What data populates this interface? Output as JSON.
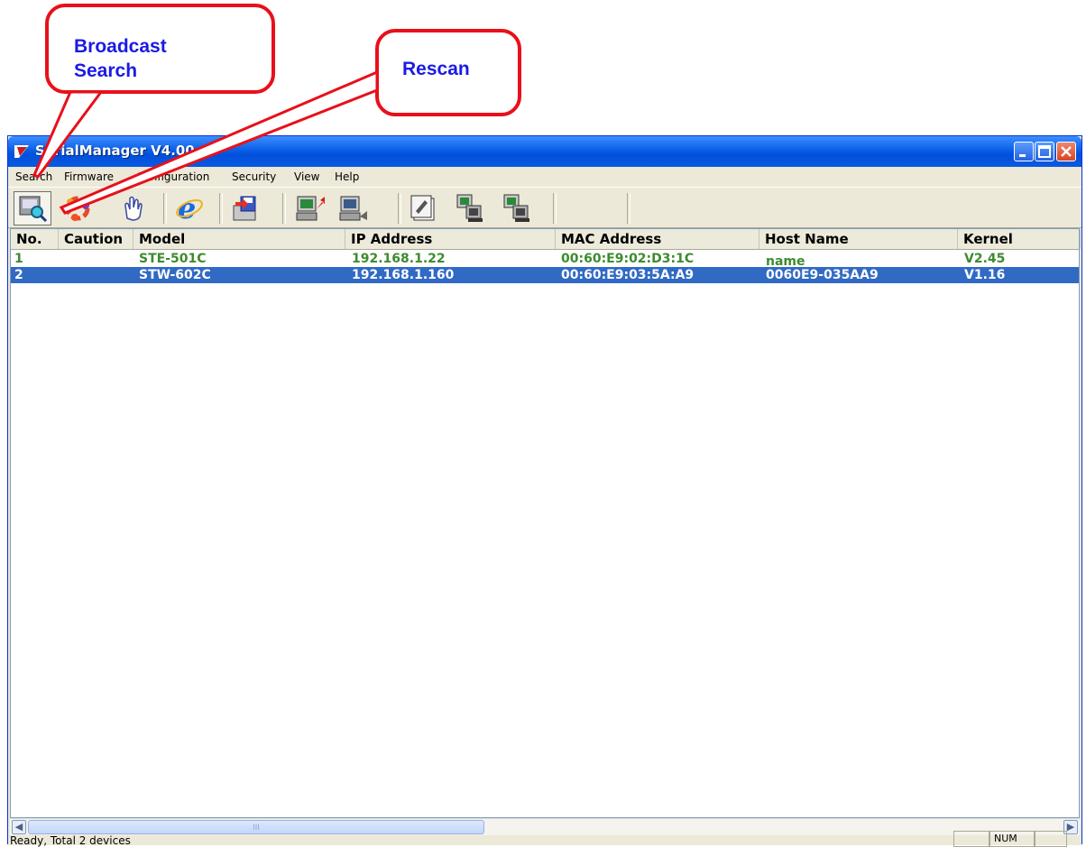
{
  "callouts": {
    "broadcast_line1": "Broadcast",
    "broadcast_line2": "Search",
    "rescan": "Rescan"
  },
  "window": {
    "title": "SerialManager V4.00 ..."
  },
  "menu": [
    "Search",
    "Firmware",
    "Configuration",
    "Security",
    "View",
    "Help"
  ],
  "toolbar_icons": [
    "broadcast-search-icon",
    "rescan-icon",
    "locate-icon",
    "web-browser-icon",
    "save-icon",
    "console-icon",
    "upload-icon",
    "config-icon",
    "network-icon",
    "network2-icon"
  ],
  "columns": [
    "No.",
    "Caution",
    "Model",
    "IP Address",
    "MAC Address",
    "Host Name",
    "Kernel"
  ],
  "rows": [
    {
      "no": "1",
      "caution": "",
      "model": "STE-501C",
      "ip": "192.168.1.22",
      "mac": "00:60:E9:02:D3:1C",
      "host": "name",
      "kernel": "V2.45"
    },
    {
      "no": "2",
      "caution": "",
      "model": "STW-602C",
      "ip": "192.168.1.160",
      "mac": "00:60:E9:03:5A:A9",
      "host": "0060E9-035AA9",
      "kernel": "V1.16"
    }
  ],
  "status": {
    "text": "Ready, Total 2 devices",
    "num": "NUM"
  },
  "scroll_glyph": "III",
  "colors": {
    "callout_border": "#e8101a",
    "callout_text": "#1a1ae6",
    "row_text": "#3e8a2e",
    "selection": "#316ac5"
  }
}
